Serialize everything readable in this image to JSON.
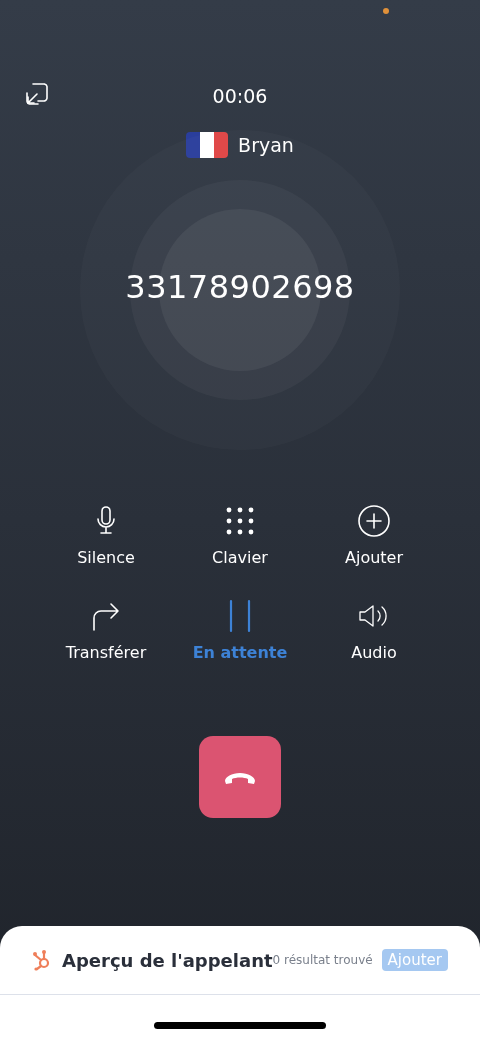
{
  "call": {
    "timer": "00:06",
    "contact": "Bryan",
    "number": "33178902698"
  },
  "actions": [
    {
      "kind": "mic",
      "label": "Silence",
      "selected": false
    },
    {
      "kind": "keypad",
      "label": "Clavier",
      "selected": false
    },
    {
      "kind": "add",
      "label": "Ajouter",
      "selected": false
    },
    {
      "kind": "transfer",
      "label": "Transférer",
      "selected": false
    },
    {
      "kind": "hold",
      "label": "En attente",
      "selected": true
    },
    {
      "kind": "speaker",
      "label": "Audio",
      "selected": false
    }
  ],
  "caller_preview": {
    "title": "Aperçu de l'appelant",
    "result": "0 résultat trouvé",
    "button": "Ajouter"
  }
}
